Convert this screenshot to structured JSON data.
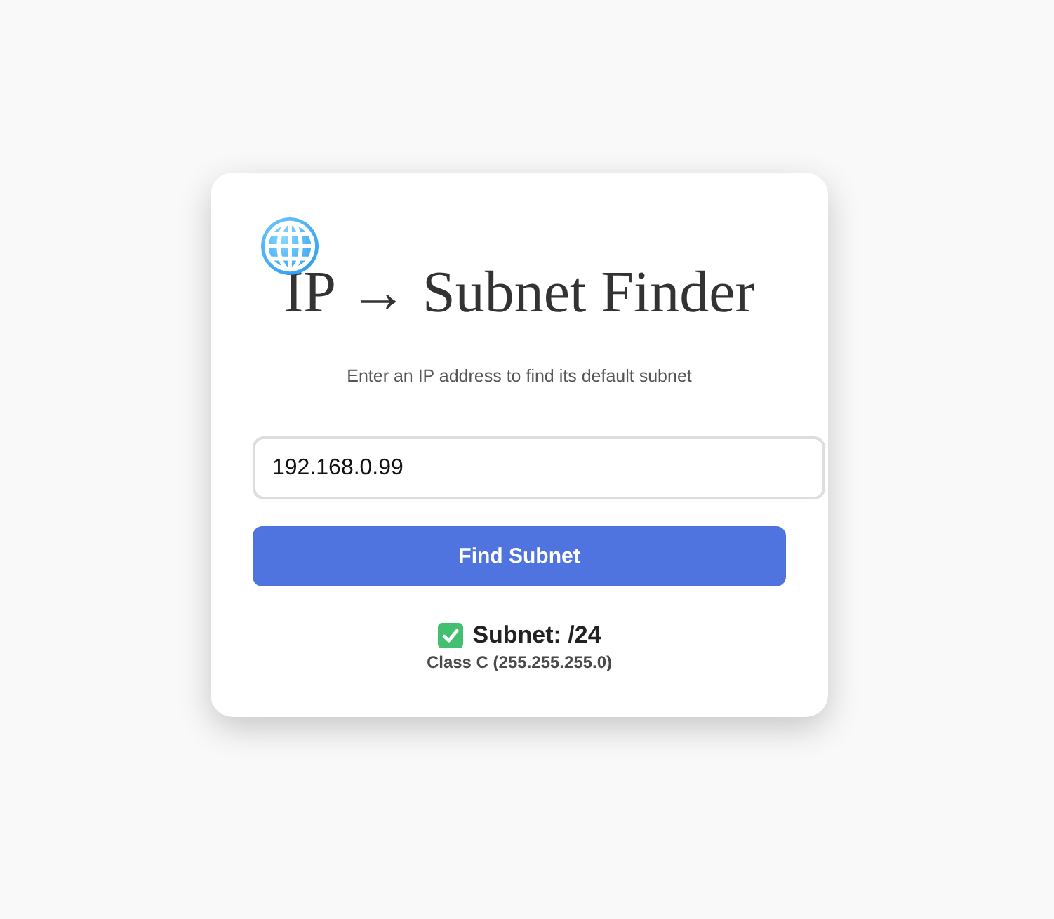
{
  "header": {
    "title": "IP → Subnet Finder",
    "subtitle": "Enter an IP address to find its default subnet"
  },
  "form": {
    "ip_field": {
      "value": "192.168.0.99"
    },
    "submit_button": "Find Subnet"
  },
  "result": {
    "ok": true,
    "subnet": "Subnet: /24",
    "class_info": "Class C (255.255.255.0)"
  }
}
